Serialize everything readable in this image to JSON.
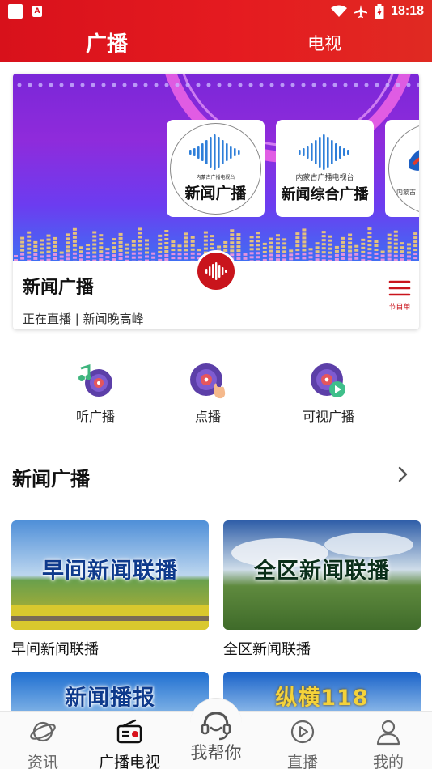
{
  "status_bar": {
    "time": "18:18",
    "icons": [
      "notification-square-icon",
      "a-badge-icon",
      "wifi-icon",
      "airplane-icon",
      "battery-icon"
    ]
  },
  "top_tabs": [
    {
      "label": "广播",
      "active": true
    },
    {
      "label": "电视",
      "active": false
    }
  ],
  "banner": {
    "stations": [
      {
        "org": "内蒙古广播电视台",
        "name": "新闻广播"
      },
      {
        "org": "内蒙古广播电视台",
        "name": "新闻综合广播"
      },
      {
        "org": "内蒙古",
        "name": ""
      }
    ],
    "current_channel": "新闻广播",
    "now_playing": "正在直播 | 新闻晚高峰",
    "schedule_label": "节目单"
  },
  "shortcuts": [
    {
      "label": "听广播",
      "icon": "music-record-icon"
    },
    {
      "label": "点播",
      "icon": "record-tap-icon"
    },
    {
      "label": "可视广播",
      "icon": "record-play-icon"
    }
  ],
  "section": {
    "title": "新闻广播"
  },
  "programs": [
    {
      "name": "早间新闻联播",
      "overlay": "早间新闻联播"
    },
    {
      "name": "全区新闻联播",
      "overlay": "全区新闻联播"
    },
    {
      "name": "",
      "overlay": "新闻播报"
    },
    {
      "name": "",
      "overlay": "纵横118"
    }
  ],
  "bottom_nav": [
    {
      "label": "资讯",
      "icon": "planet-icon",
      "active": false
    },
    {
      "label": "广播电视",
      "icon": "radio-icon",
      "active": true
    },
    {
      "label": "我帮你",
      "icon": "headset-icon",
      "active": false
    },
    {
      "label": "直播",
      "icon": "play-circle-icon",
      "active": false
    },
    {
      "label": "我的",
      "icon": "user-icon",
      "active": false
    }
  ],
  "colors": {
    "brand_red": "#d8111b",
    "banner_purple": "#7a27d8",
    "accent_text": "#c9141c"
  }
}
